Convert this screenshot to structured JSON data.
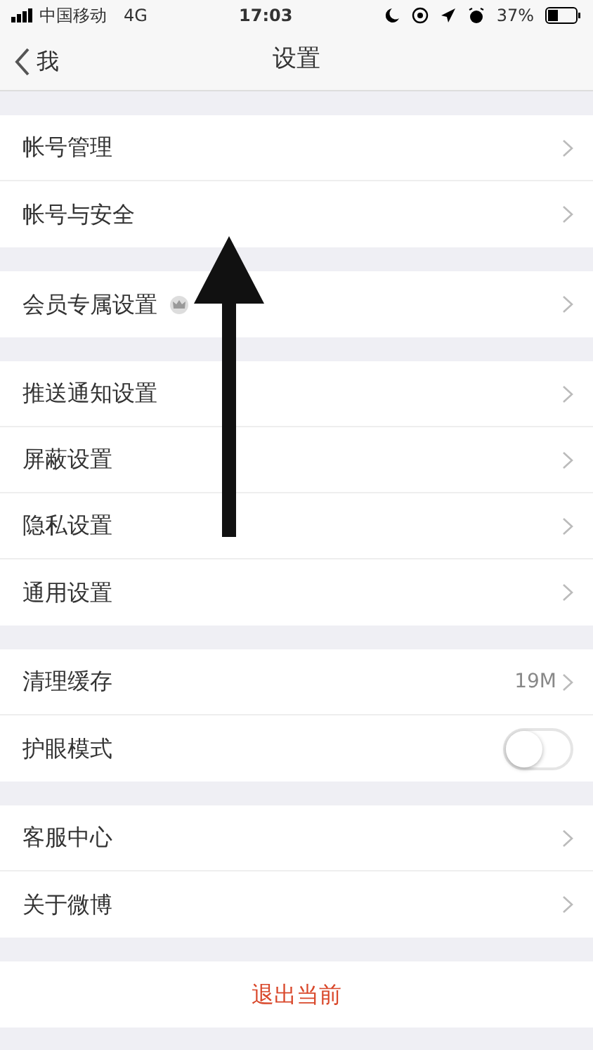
{
  "status_bar": {
    "carrier": "中国移动",
    "network": "4G",
    "time": "17:03",
    "battery": "37%"
  },
  "nav": {
    "back_label": "我",
    "title": "设置"
  },
  "groups": [
    [
      {
        "kind": "link",
        "label": "帐号管理"
      },
      {
        "kind": "link",
        "label": "帐号与安全"
      }
    ],
    [
      {
        "kind": "vip",
        "label": "会员专属设置"
      }
    ],
    [
      {
        "kind": "link",
        "label": "推送通知设置"
      },
      {
        "kind": "link",
        "label": "屏蔽设置"
      },
      {
        "kind": "link",
        "label": "隐私设置"
      },
      {
        "kind": "link",
        "label": "通用设置"
      }
    ],
    [
      {
        "kind": "value",
        "label": "清理缓存",
        "value": "19M"
      },
      {
        "kind": "toggle",
        "label": "护眼模式",
        "on": false
      }
    ],
    [
      {
        "kind": "link",
        "label": "客服中心"
      },
      {
        "kind": "link",
        "label": "关于微博"
      }
    ]
  ],
  "logout": {
    "label": "退出当前"
  }
}
